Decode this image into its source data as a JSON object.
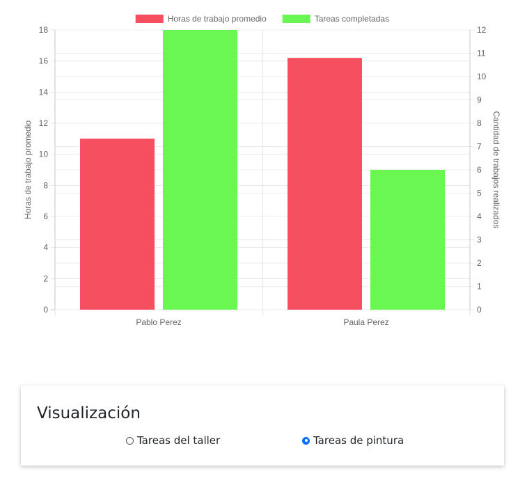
{
  "chart_data": {
    "type": "bar",
    "categories": [
      "Pablo Perez",
      "Paula Perez"
    ],
    "series": [
      {
        "name": "Horas de trabajo promedio",
        "axis": "left",
        "color": "#f64f5f",
        "values": [
          11,
          16.2
        ]
      },
      {
        "name": "Tareas completadas",
        "axis": "right",
        "color": "#6af752",
        "values": [
          12,
          6
        ]
      }
    ],
    "y_left": {
      "label": "Horas de trabajo promedio",
      "min": 0,
      "max": 18,
      "ticks": [
        0,
        2,
        4,
        6,
        8,
        10,
        12,
        14,
        16,
        18
      ]
    },
    "y_right": {
      "label": "Cantidad de trabajos realizados",
      "min": 0,
      "max": 12,
      "ticks": [
        0,
        1,
        2,
        3,
        4,
        5,
        6,
        7,
        8,
        9,
        10,
        11,
        12
      ]
    },
    "legend": "top",
    "grid": true
  },
  "visualization": {
    "title": "Visualización",
    "options": [
      {
        "label": "Tareas del taller",
        "checked": false
      },
      {
        "label": "Tareas de pintura",
        "checked": true
      }
    ]
  }
}
